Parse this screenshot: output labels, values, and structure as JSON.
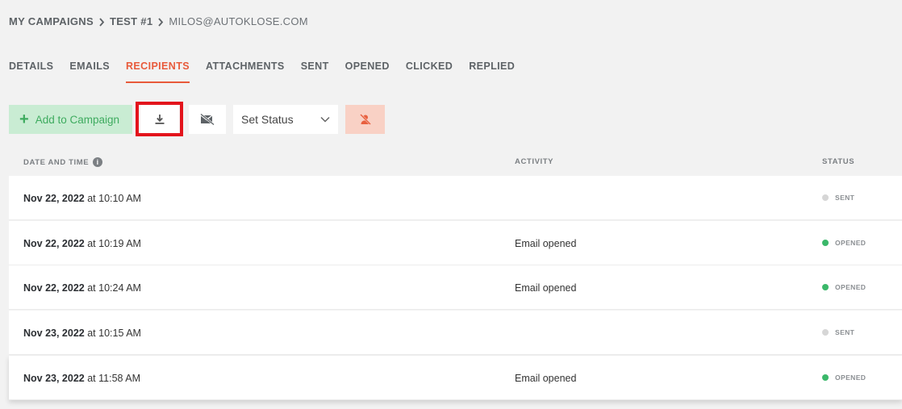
{
  "breadcrumb": {
    "root": "MY CAMPAIGNS",
    "campaign": "TEST #1",
    "recipient": "MILOS@AUTOKLOSE.COM"
  },
  "tabs": [
    {
      "label": "DETAILS"
    },
    {
      "label": "EMAILS"
    },
    {
      "label": "RECIPIENTS",
      "active": true
    },
    {
      "label": "ATTACHMENTS"
    },
    {
      "label": "SENT"
    },
    {
      "label": "OPENED"
    },
    {
      "label": "CLICKED"
    },
    {
      "label": "REPLIED"
    }
  ],
  "toolbar": {
    "add_label": "Add to Campaign",
    "set_status_label": "Set Status",
    "download_icon": "download-icon",
    "mail_icon": "mail-off-icon",
    "unsubscribe_icon": "user-remove-icon"
  },
  "table": {
    "headers": {
      "date": "DATE AND TIME",
      "activity": "ACTIVITY",
      "status": "STATUS"
    },
    "rows": [
      {
        "date": "Nov 22, 2022",
        "time": "at 10:10 AM",
        "activity": "",
        "status": "SENT"
      },
      {
        "date": "Nov 22, 2022",
        "time": "at 10:19 AM",
        "activity": "Email opened",
        "status": "OPENED"
      },
      {
        "date": "Nov 22, 2022",
        "time": "at 10:24 AM",
        "activity": "Email opened",
        "status": "OPENED"
      },
      {
        "date": "Nov 23, 2022",
        "time": "at 10:15 AM",
        "activity": "",
        "status": "SENT"
      },
      {
        "date": "Nov 23, 2022",
        "time": "at 11:58 AM",
        "activity": "Email opened",
        "status": "OPENED"
      }
    ]
  },
  "colors": {
    "accent": "#e85a3b",
    "add_bg": "#c9ecd3",
    "add_text": "#3eab5f",
    "sent_dot": "#d6d6d6",
    "opened_dot": "#3bb86a",
    "highlight": "#e3141c"
  }
}
